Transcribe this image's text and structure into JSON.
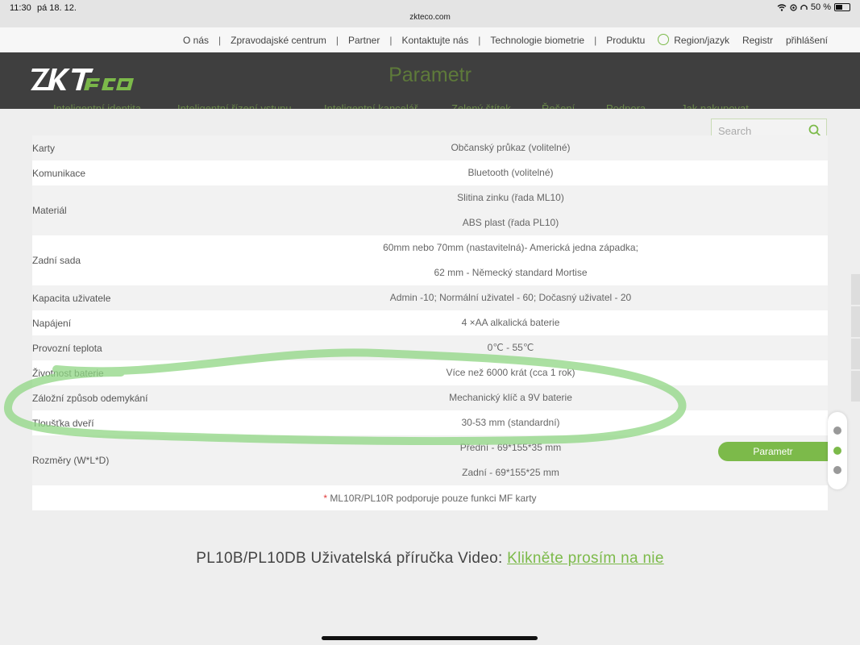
{
  "status_bar": {
    "time": "11:30",
    "date": "pá 18. 12.",
    "url": "zkteco.com",
    "battery": "50 %"
  },
  "top_nav": {
    "items": [
      "O nás",
      "Zpravodajské centrum",
      "Partner",
      "Kontaktujte nás",
      "Technologie biometrie",
      "Produktu"
    ],
    "region": "Region/jazyk",
    "register": "Registr",
    "login": "přihlášení"
  },
  "header": {
    "title": "Parametr",
    "nav": [
      "Inteligentní identita",
      "Inteligentní řízení vstupu",
      "Inteligentní kancelář",
      "Zelený štítek",
      "Řešení",
      "Podpora",
      "Jak nakupovat"
    ]
  },
  "search": {
    "placeholder": "Search"
  },
  "specs": [
    {
      "label": "Karty",
      "values": [
        "Občanský průkaz (volitelné)"
      ]
    },
    {
      "label": "Komunikace",
      "values": [
        "Bluetooth (volitelné)"
      ]
    },
    {
      "label": "Materiál",
      "values": [
        "Slitina zinku (řada ML10)",
        "ABS plast (řada PL10)"
      ]
    },
    {
      "label": "Zadní sada",
      "values": [
        "60mm nebo 70mm (nastavitelná)- Americká jedna západka;",
        "62 mm - Německý standard Mortise"
      ]
    },
    {
      "label": "Kapacita uživatele",
      "values": [
        "Admin -10; Normální uživatel - 60; Dočasný uživatel - 20"
      ]
    },
    {
      "label": "Napájení",
      "values": [
        "4 ×AA alkalická baterie"
      ]
    },
    {
      "label": "Provozní teplota",
      "values": [
        "0℃ - 55℃"
      ]
    },
    {
      "label": "Životnost baterie",
      "values": [
        "Více než 6000 krát (cca 1 rok)"
      ]
    },
    {
      "label": "Záložní způsob odemykání",
      "values": [
        "Mechanický klíč a 9V baterie"
      ]
    },
    {
      "label": "Tloušťka dveří",
      "values": [
        "30-53 mm (standardní)"
      ]
    },
    {
      "label": "Rozměry (W*L*D)",
      "values": [
        "Přední - 69*155*35 mm",
        "Zadní - 69*155*25 mm"
      ]
    }
  ],
  "note": {
    "star": "*",
    "text": " ML10R/PL10R podporuje pouze funkci MF karty"
  },
  "side_button": "Parametr",
  "manual": {
    "text": "PL10B/PL10DB Uživatelská příručka Video: ",
    "link": "Klikněte prosím na nie"
  },
  "colors": {
    "accent": "#7cba4a",
    "header_bg": "#3f3f3f",
    "highlight": "#8fd683"
  }
}
